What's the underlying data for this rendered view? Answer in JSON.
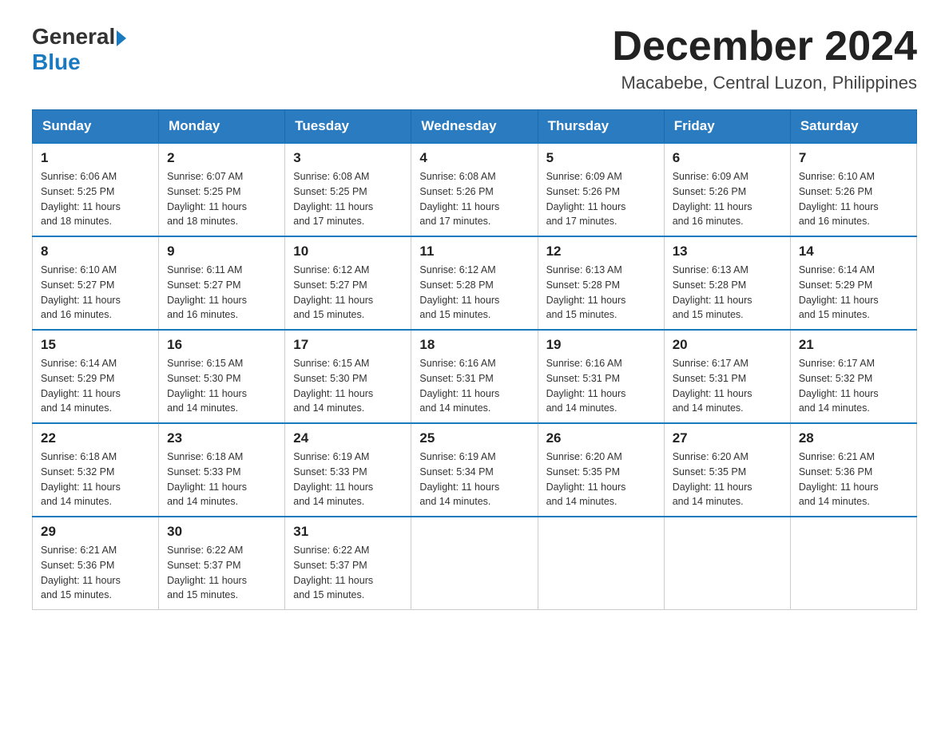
{
  "header": {
    "logo_general": "General",
    "logo_blue": "Blue",
    "month_title": "December 2024",
    "location": "Macabebe, Central Luzon, Philippines"
  },
  "weekdays": [
    "Sunday",
    "Monday",
    "Tuesday",
    "Wednesday",
    "Thursday",
    "Friday",
    "Saturday"
  ],
  "weeks": [
    [
      {
        "day": "1",
        "sunrise": "6:06 AM",
        "sunset": "5:25 PM",
        "daylight": "11 hours and 18 minutes."
      },
      {
        "day": "2",
        "sunrise": "6:07 AM",
        "sunset": "5:25 PM",
        "daylight": "11 hours and 18 minutes."
      },
      {
        "day": "3",
        "sunrise": "6:08 AM",
        "sunset": "5:25 PM",
        "daylight": "11 hours and 17 minutes."
      },
      {
        "day": "4",
        "sunrise": "6:08 AM",
        "sunset": "5:26 PM",
        "daylight": "11 hours and 17 minutes."
      },
      {
        "day": "5",
        "sunrise": "6:09 AM",
        "sunset": "5:26 PM",
        "daylight": "11 hours and 17 minutes."
      },
      {
        "day": "6",
        "sunrise": "6:09 AM",
        "sunset": "5:26 PM",
        "daylight": "11 hours and 16 minutes."
      },
      {
        "day": "7",
        "sunrise": "6:10 AM",
        "sunset": "5:26 PM",
        "daylight": "11 hours and 16 minutes."
      }
    ],
    [
      {
        "day": "8",
        "sunrise": "6:10 AM",
        "sunset": "5:27 PM",
        "daylight": "11 hours and 16 minutes."
      },
      {
        "day": "9",
        "sunrise": "6:11 AM",
        "sunset": "5:27 PM",
        "daylight": "11 hours and 16 minutes."
      },
      {
        "day": "10",
        "sunrise": "6:12 AM",
        "sunset": "5:27 PM",
        "daylight": "11 hours and 15 minutes."
      },
      {
        "day": "11",
        "sunrise": "6:12 AM",
        "sunset": "5:28 PM",
        "daylight": "11 hours and 15 minutes."
      },
      {
        "day": "12",
        "sunrise": "6:13 AM",
        "sunset": "5:28 PM",
        "daylight": "11 hours and 15 minutes."
      },
      {
        "day": "13",
        "sunrise": "6:13 AM",
        "sunset": "5:28 PM",
        "daylight": "11 hours and 15 minutes."
      },
      {
        "day": "14",
        "sunrise": "6:14 AM",
        "sunset": "5:29 PM",
        "daylight": "11 hours and 15 minutes."
      }
    ],
    [
      {
        "day": "15",
        "sunrise": "6:14 AM",
        "sunset": "5:29 PM",
        "daylight": "11 hours and 14 minutes."
      },
      {
        "day": "16",
        "sunrise": "6:15 AM",
        "sunset": "5:30 PM",
        "daylight": "11 hours and 14 minutes."
      },
      {
        "day": "17",
        "sunrise": "6:15 AM",
        "sunset": "5:30 PM",
        "daylight": "11 hours and 14 minutes."
      },
      {
        "day": "18",
        "sunrise": "6:16 AM",
        "sunset": "5:31 PM",
        "daylight": "11 hours and 14 minutes."
      },
      {
        "day": "19",
        "sunrise": "6:16 AM",
        "sunset": "5:31 PM",
        "daylight": "11 hours and 14 minutes."
      },
      {
        "day": "20",
        "sunrise": "6:17 AM",
        "sunset": "5:31 PM",
        "daylight": "11 hours and 14 minutes."
      },
      {
        "day": "21",
        "sunrise": "6:17 AM",
        "sunset": "5:32 PM",
        "daylight": "11 hours and 14 minutes."
      }
    ],
    [
      {
        "day": "22",
        "sunrise": "6:18 AM",
        "sunset": "5:32 PM",
        "daylight": "11 hours and 14 minutes."
      },
      {
        "day": "23",
        "sunrise": "6:18 AM",
        "sunset": "5:33 PM",
        "daylight": "11 hours and 14 minutes."
      },
      {
        "day": "24",
        "sunrise": "6:19 AM",
        "sunset": "5:33 PM",
        "daylight": "11 hours and 14 minutes."
      },
      {
        "day": "25",
        "sunrise": "6:19 AM",
        "sunset": "5:34 PM",
        "daylight": "11 hours and 14 minutes."
      },
      {
        "day": "26",
        "sunrise": "6:20 AM",
        "sunset": "5:35 PM",
        "daylight": "11 hours and 14 minutes."
      },
      {
        "day": "27",
        "sunrise": "6:20 AM",
        "sunset": "5:35 PM",
        "daylight": "11 hours and 14 minutes."
      },
      {
        "day": "28",
        "sunrise": "6:21 AM",
        "sunset": "5:36 PM",
        "daylight": "11 hours and 14 minutes."
      }
    ],
    [
      {
        "day": "29",
        "sunrise": "6:21 AM",
        "sunset": "5:36 PM",
        "daylight": "11 hours and 15 minutes."
      },
      {
        "day": "30",
        "sunrise": "6:22 AM",
        "sunset": "5:37 PM",
        "daylight": "11 hours and 15 minutes."
      },
      {
        "day": "31",
        "sunrise": "6:22 AM",
        "sunset": "5:37 PM",
        "daylight": "11 hours and 15 minutes."
      },
      null,
      null,
      null,
      null
    ]
  ],
  "labels": {
    "sunrise": "Sunrise:",
    "sunset": "Sunset:",
    "daylight": "Daylight:"
  }
}
